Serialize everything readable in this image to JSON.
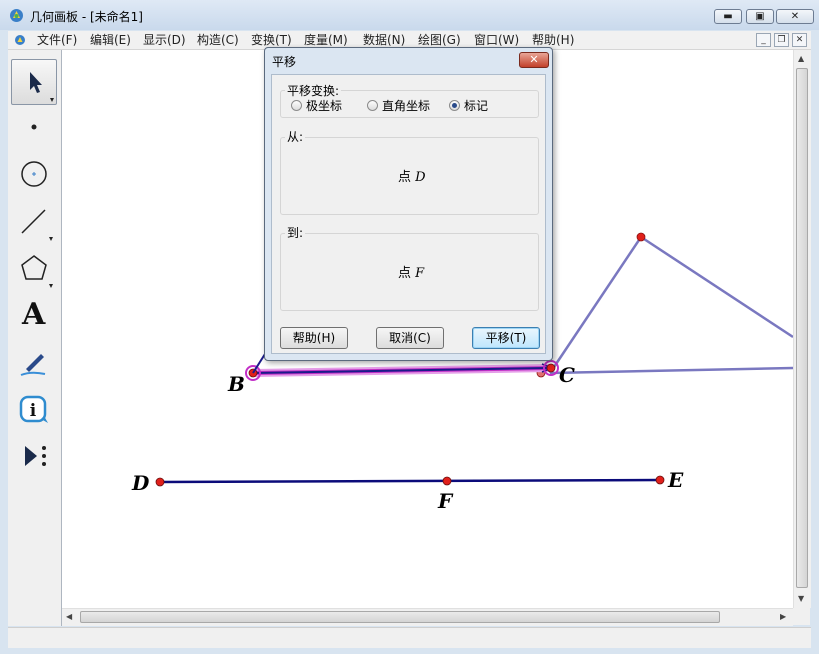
{
  "window": {
    "title": "几何画板 - [未命名1]"
  },
  "menu": [
    "文件(F)",
    "编辑(E)",
    "显示(D)",
    "构造(C)",
    "变换(T)",
    "度量(M)",
    "数据(N)",
    "绘图(G)",
    "窗口(W)",
    "帮助(H)"
  ],
  "toolbox": {
    "tools": [
      "arrow-select-icon",
      "point-icon",
      "compass-icon",
      "straightedge-icon",
      "polygon-icon",
      "text-icon",
      "marker-icon",
      "info-icon",
      "custom-tool-icon"
    ],
    "text_tool_glyph": "A"
  },
  "canvas": {
    "labels": {
      "B": "B",
      "C": "C",
      "D": "D",
      "E": "E",
      "F": "F"
    },
    "colors": {
      "segment_BC": "#c22fc7",
      "segment_DE": "#0b0b7a",
      "polyline": "#7a78c0",
      "point_fill": "#e0201b"
    }
  },
  "dialog": {
    "title": "平移",
    "close_glyph": "✕",
    "transform_group_label": "平移变换:",
    "options": [
      {
        "label": "极坐标",
        "checked": false
      },
      {
        "label": "直角坐标",
        "checked": false
      },
      {
        "label": "标记",
        "checked": true
      }
    ],
    "from_label": "从:",
    "from_prefix": "点",
    "from_point": "D",
    "to_label": "到:",
    "to_prefix": "点",
    "to_point": "F",
    "buttons": {
      "help": "帮助(H)",
      "cancel": "取消(C)",
      "ok": "平移(T)"
    }
  }
}
